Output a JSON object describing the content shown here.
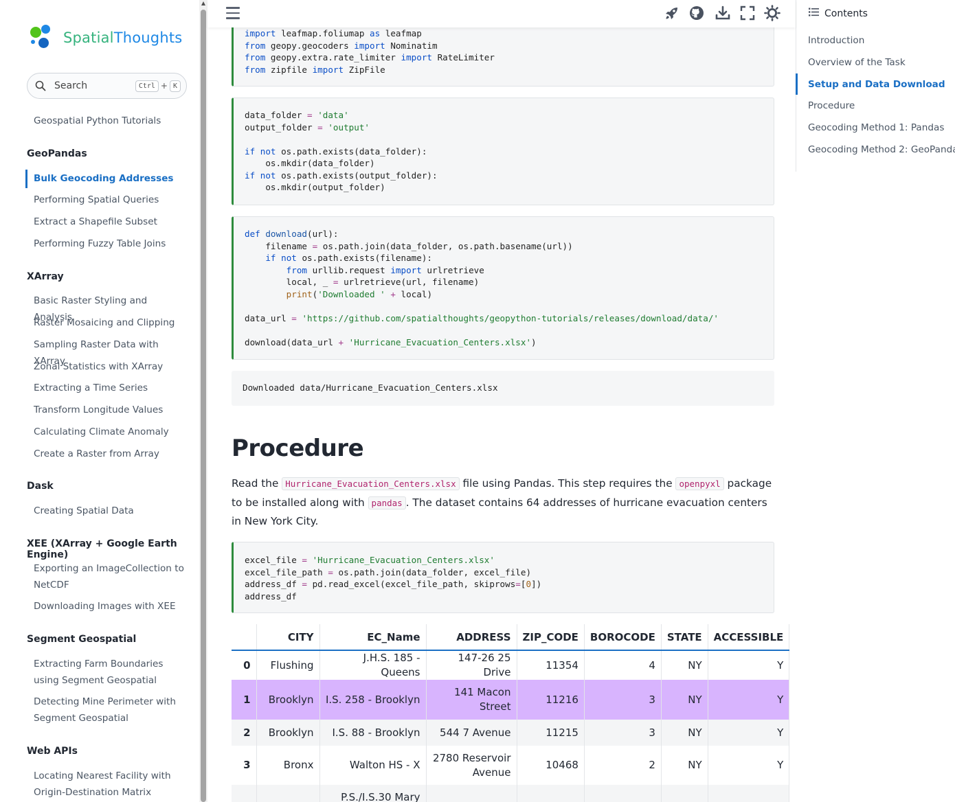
{
  "brand": {
    "part1": "Spatial",
    "part2": "Thoughts"
  },
  "search": {
    "label": "Search",
    "key1": "Ctrl",
    "plus": "+",
    "key2": "K"
  },
  "sidebar": {
    "top_link": "Geospatial Python Tutorials",
    "sections": [
      {
        "title": "GeoPandas",
        "items": [
          "Bulk Geocoding Addresses",
          "Performing Spatial Queries",
          "Extract a Shapefile Subset",
          "Performing Fuzzy Table Joins"
        ]
      },
      {
        "title": "XArray",
        "items": [
          "Basic Raster Styling and Analysis",
          "Raster Mosaicing and Clipping",
          "Sampling Raster Data with XArray",
          "Zonal Statistics with XArray",
          "Extracting a Time Series",
          "Transform Longitude Values",
          "Calculating Climate Anomaly",
          "Create a Raster from Array"
        ]
      },
      {
        "title": "Dask",
        "items": [
          "Creating Spatial Data"
        ]
      },
      {
        "title": "XEE (XArray + Google Earth Engine)",
        "items": [
          "Exporting an ImageCollection to NetCDF",
          "Downloading Images with XEE"
        ]
      },
      {
        "title": "Segment Geospatial",
        "items": [
          "Extracting Farm Boundaries using Segment Geospatial",
          "Detecting Mine Perimeter with Segment Geospatial"
        ]
      },
      {
        "title": "Web APIs",
        "items": [
          "Locating Nearest Facility with Origin-Destination Matrix"
        ]
      }
    ],
    "active_item": "Bulk Geocoding Addresses"
  },
  "header": {
    "icons": [
      "menu-icon",
      "rocket-icon",
      "github-icon",
      "download-icon",
      "fullscreen-icon",
      "theme-toggle-icon"
    ]
  },
  "toc": {
    "title": "Contents",
    "items": [
      "Introduction",
      "Overview of the Task",
      "Setup and Data Download",
      "Procedure",
      "Geocoding Method 1: Pandas",
      "Geocoding Method 2: GeoPandas"
    ],
    "active": "Setup and Data Download"
  },
  "code": {
    "cell1": [
      "import leafmap.foliumap as leafmap",
      "from geopy.geocoders import Nominatim",
      "from geopy.extra.rate_limiter import RateLimiter",
      "from zipfile import ZipFile"
    ],
    "cell2": [
      "data_folder = 'data'",
      "output_folder = 'output'",
      "",
      "if not os.path.exists(data_folder):",
      "    os.mkdir(data_folder)",
      "if not os.path.exists(output_folder):",
      "    os.mkdir(output_folder)"
    ],
    "cell3": [
      "def download(url):",
      "    filename = os.path.join(data_folder, os.path.basename(url))",
      "    if not os.path.exists(filename):",
      "        from urllib.request import urlretrieve",
      "        local, _ = urlretrieve(url, filename)",
      "        print('Downloaded ' + local)",
      "",
      "data_url = 'https://github.com/spatialthoughts/geopython-tutorials/releases/download/data/'",
      "",
      "download(data_url + 'Hurricane_Evacuation_Centers.xlsx')"
    ],
    "output3": "Downloaded data/Hurricane_Evacuation_Centers.xlsx",
    "cell4": [
      "excel_file = 'Hurricane_Evacuation_Centers.xlsx'",
      "excel_file_path = os.path.join(data_folder, excel_file)",
      "address_df = pd.read_excel(excel_file_path, skiprows=[0])",
      "address_df"
    ]
  },
  "procedure": {
    "title": "Procedure",
    "p_before_file": "Read the ",
    "file_code": "Hurricane_Evacuation_Centers.xlsx",
    "p_after_file": " file using Pandas. This step requires the ",
    "pkg_code": "openpyxl",
    "p_after_pkg": " package to be installed along with ",
    "pandas_code": "pandas",
    "p_end": ". The dataset contains 64 addresses of hurricane evacuation centers in New York City."
  },
  "table": {
    "columns": [
      "",
      "CITY",
      "EC_Name",
      "ADDRESS",
      "ZIP_CODE",
      "BOROCODE",
      "STATE",
      "ACCESSIBLE"
    ],
    "rows": [
      [
        "0",
        "Flushing",
        "J.H.S. 185 - Queens",
        "147-26 25 Drive",
        "11354",
        "4",
        "NY",
        "Y"
      ],
      [
        "1",
        "Brooklyn",
        "I.S. 258 - Brooklyn",
        "141 Macon Street",
        "11216",
        "3",
        "NY",
        "Y"
      ],
      [
        "2",
        "Brooklyn",
        "I.S. 88 - Brooklyn",
        "544 7 Avenue",
        "11215",
        "3",
        "NY",
        "Y"
      ],
      [
        "3",
        "Bronx",
        "Walton HS - X",
        "2780 Reservoir Avenue",
        "10468",
        "2",
        "NY",
        "Y"
      ],
      [
        "",
        "",
        "P.S./I.S.30 Mary",
        "",
        "",
        "",
        "",
        ""
      ]
    ],
    "highlight_color": "#d8b4fe"
  }
}
